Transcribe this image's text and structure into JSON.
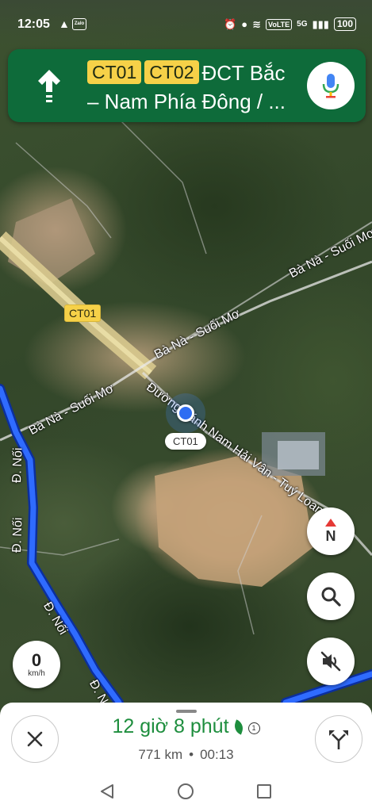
{
  "status_bar": {
    "time": "12:05",
    "app_badge": "Zalo",
    "network_badge": "VoLTE",
    "signal_text": "5G",
    "battery": "100"
  },
  "banner": {
    "shields": [
      "CT01",
      "CT02"
    ],
    "street": "ĐCT Bắc – Nam Phía Đông / ..."
  },
  "map": {
    "labels": {
      "ba_na_top": "Bà Nà - Suối Mơ",
      "ba_na_mid": "Bà Nà - Suối Mơ",
      "ba_na_left": "Bà Nà - Suối Mơ",
      "bypass_road": "Đường tránh Nam Hải Vân - Tuý Loan",
      "noi_1": "Đ. Nối",
      "noi_2": "Đ. Nối",
      "noi_3": "Đ. Nối",
      "noi_4": "Đ. N"
    },
    "map_shield": "CT01",
    "current_road_chip": "CT01"
  },
  "controls": {
    "compass_letter": "N",
    "speed_value": "0",
    "speed_unit": "km/h"
  },
  "trip": {
    "duration": "12 giờ 8 phút",
    "incident_count": "1",
    "distance": "771 km",
    "arrival_time": "00:13",
    "separator": "•"
  },
  "colors": {
    "banner_bg": "#0e6b3a",
    "shield_bg": "#f6d148",
    "route_blue": "#1f4fe0",
    "eta_green": "#1e8e3e"
  }
}
